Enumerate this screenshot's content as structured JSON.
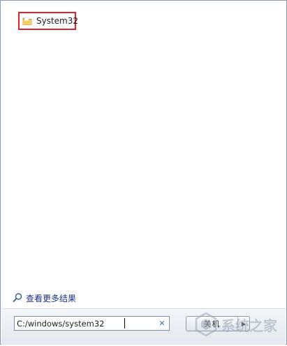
{
  "results": {
    "items": [
      {
        "label": "System32",
        "icon": "folder-icon"
      }
    ]
  },
  "see_more": {
    "label": "查看更多结果",
    "icon": "search-icon"
  },
  "search": {
    "value": "C:/windows/system32",
    "clear_icon": "close-icon"
  },
  "shutdown": {
    "label": "关机"
  },
  "watermark": {
    "text": "系统之家"
  },
  "colors": {
    "highlight_border": "#e0232b",
    "link": "#1e3287",
    "frame": "#8a99ab"
  }
}
